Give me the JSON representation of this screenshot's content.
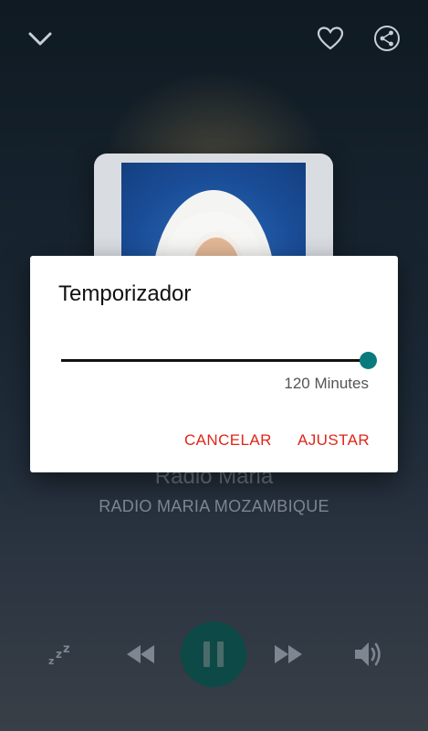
{
  "header": {
    "collapse_icon": "chevron-down-icon",
    "favorite_icon": "heart-outline-icon",
    "share_icon": "share-icon"
  },
  "now_playing": {
    "title": "Radio Maria",
    "subtitle": "RADIO MARIA MOZAMBIQUE"
  },
  "controls": {
    "sleep_icon": "sleep-zzz-icon",
    "prev_icon": "rewind-icon",
    "play_icon": "pause-icon",
    "next_icon": "fast-forward-icon",
    "volume_icon": "volume-icon"
  },
  "dialog": {
    "title": "Temporizador",
    "slider_value_label": "120 Minutes",
    "slider_fraction": 1.0,
    "cancel_label": "CANCELAR",
    "ok_label": "AJUSTAR"
  },
  "colors": {
    "accent": "#0a7b7c",
    "dialog_button": "#e0261b",
    "play_button": "#0d4a47"
  }
}
